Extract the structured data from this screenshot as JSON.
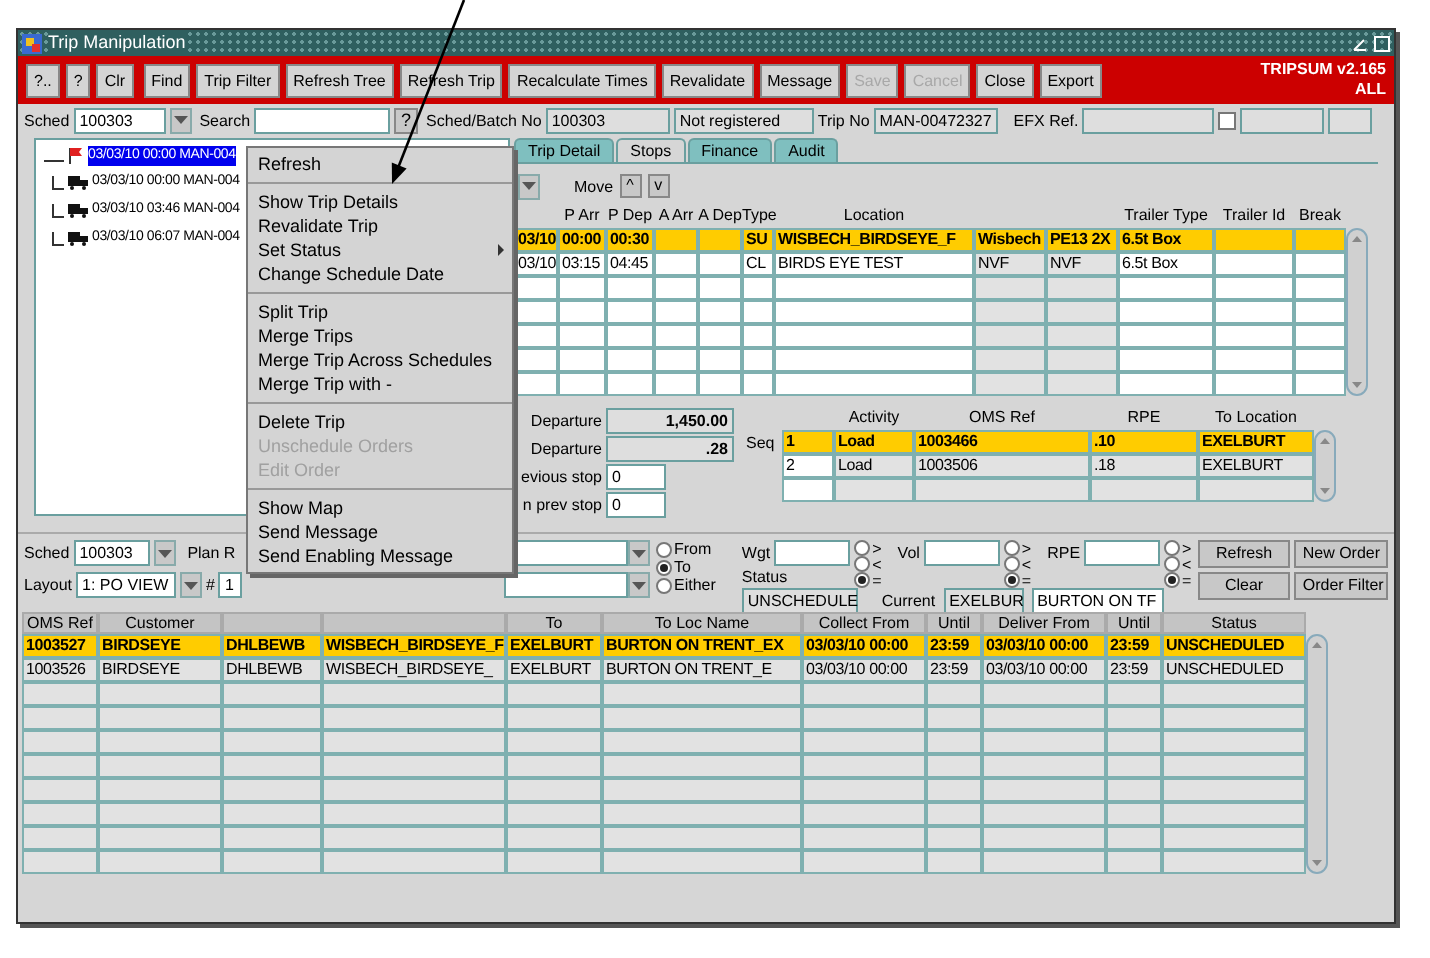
{
  "window": {
    "title": "Trip Manipulation"
  },
  "toolbar": {
    "buttons": [
      {
        "label": "?..",
        "disabled": false
      },
      {
        "label": "?",
        "disabled": false
      },
      {
        "label": "Clr",
        "disabled": false
      },
      {
        "label": "Find",
        "disabled": false
      },
      {
        "label": "Trip Filter",
        "disabled": false
      },
      {
        "label": "Refresh Tree",
        "disabled": false
      },
      {
        "label": "Refresh Trip",
        "disabled": false
      },
      {
        "label": "Recalculate Times",
        "disabled": false
      },
      {
        "label": "Revalidate",
        "disabled": false
      },
      {
        "label": "Message",
        "disabled": false
      },
      {
        "label": "Save",
        "disabled": true
      },
      {
        "label": "Cancel",
        "disabled": true
      },
      {
        "label": "Close",
        "disabled": false
      },
      {
        "label": "Export",
        "disabled": false
      }
    ],
    "app_version": "TRIPSUM v2.165",
    "scope": "ALL"
  },
  "header": {
    "sched_label": "Sched",
    "sched": "100303",
    "search_label": "Search",
    "search_button": "?",
    "batch_label": "Sched/Batch No",
    "batch": "100303",
    "registration": "Not registered",
    "trip_no_label": "Trip No",
    "trip_no": "MAN-00472327",
    "efx_label": "EFX Ref.",
    "efx_checked": false
  },
  "tree": {
    "items": [
      {
        "label": "03/03/10 00:00 MAN-004",
        "selected": true,
        "children": [
          {
            "label": "03/03/10 00:00 MAN-004",
            "selected": false
          },
          {
            "label": "03/03/10 03:46 MAN-004",
            "selected": false
          },
          {
            "label": "03/03/10 06:07 MAN-004",
            "selected": false
          }
        ]
      }
    ]
  },
  "tabs": [
    {
      "label": "Trip Detail",
      "selected": false
    },
    {
      "label": "Stops",
      "selected": true
    },
    {
      "label": "Finance",
      "selected": false
    },
    {
      "label": "Audit",
      "selected": false
    }
  ],
  "stops": {
    "move_label": "Move",
    "move_up": "^",
    "move_down": "v",
    "columns": [
      null,
      "P Arr",
      "P Dep",
      "A Arr",
      "A Dep",
      "Type",
      "Location",
      null,
      null,
      "Trailer Type",
      "Trailer Id",
      "Break"
    ],
    "rows": [
      {
        "selected": true,
        "cells": [
          "03/10",
          "00:00",
          "00:30",
          null,
          null,
          "SU",
          "WISBECH_BIRDSEYE_F",
          "Wisbech",
          "PE13 2X",
          "6.5t Box",
          null,
          null
        ]
      },
      {
        "selected": false,
        "cells": [
          "03/10",
          "03:15",
          "04:45",
          null,
          null,
          "CL",
          "BIRDS EYE TEST",
          "NVF",
          "NVF",
          "6.5t Box",
          null,
          null
        ]
      }
    ]
  },
  "stop_summary": [
    {
      "kind": "total",
      "label": "Departure",
      "value": "1,450.00"
    },
    {
      "kind": "total",
      "label": "Departure",
      "value": ".28"
    },
    {
      "kind": "input",
      "label": "evious stop",
      "value": "0"
    },
    {
      "kind": "input",
      "label": "n prev stop",
      "value": "0"
    }
  ],
  "activities": {
    "seq_label": "Seq",
    "columns": [
      null,
      "Activity",
      "OMS Ref",
      "RPE",
      "To Location"
    ],
    "rows": [
      {
        "selected": true,
        "cells": [
          "1",
          "Load",
          "1003466",
          ".10",
          "EXELBURT"
        ]
      },
      {
        "selected": false,
        "cells": [
          "2",
          "Load",
          "1003506",
          ".18",
          "EXELBURT"
        ]
      }
    ]
  },
  "filters": {
    "sched_label": "Sched",
    "sched": "100303",
    "plan_label": "Plan R",
    "layout_label": "Layout",
    "layout": "1: PO VIEW",
    "hash_label": "#",
    "hash_value": "1",
    "direction": [
      {
        "label": "From",
        "selected": false
      },
      {
        "label": "To",
        "selected": true
      },
      {
        "label": "Either",
        "selected": false
      }
    ],
    "measures": [
      {
        "label": "Wgt",
        "compare": [
          {
            "label": ">",
            "selected": false
          },
          {
            "label": "<",
            "selected": false
          },
          {
            "label": "=",
            "selected": true
          }
        ]
      },
      {
        "label": "Vol",
        "compare": [
          {
            "label": ">",
            "selected": false
          },
          {
            "label": "<",
            "selected": false
          },
          {
            "label": "=",
            "selected": true
          }
        ]
      },
      {
        "label": "RPE",
        "compare": [
          {
            "label": ">",
            "selected": false
          },
          {
            "label": "<",
            "selected": false
          },
          {
            "label": "=",
            "selected": true
          }
        ]
      }
    ],
    "status_label": "Status",
    "status": "UNSCHEDULE",
    "current_label": "Current",
    "current_code": "EXELBUR",
    "current_name": "BURTON ON TF",
    "buttons": [
      "Refresh",
      "New Order",
      "Clear",
      "Order Filter"
    ]
  },
  "orders": {
    "columns": [
      "OMS Ref",
      "Customer",
      null,
      null,
      "To",
      "To Loc Name",
      "Collect From",
      "Until",
      "Deliver From",
      "Until",
      "Status"
    ],
    "rows": [
      {
        "selected": true,
        "cells": [
          "1003527",
          "BIRDSEYE",
          "DHLBEWB",
          "WISBECH_BIRDSEYE_F",
          "EXELBURT",
          "BURTON ON TRENT_EX",
          "03/03/10 00:00",
          "23:59",
          "03/03/10 00:00",
          "23:59",
          "UNSCHEDULED"
        ]
      },
      {
        "selected": false,
        "cells": [
          "1003526",
          "BIRDSEYE",
          "DHLBEWB",
          "WISBECH_BIRDSEYE_",
          "EXELBURT",
          "BURTON ON TRENT_E",
          "03/03/10 00:00",
          "23:59",
          "03/03/10 00:00",
          "23:59",
          "UNSCHEDULED"
        ]
      }
    ]
  },
  "context_menu": {
    "items": [
      {
        "kind": "item",
        "label": "Refresh",
        "disabled": false,
        "submenu": false
      },
      {
        "kind": "separator"
      },
      {
        "kind": "item",
        "label": "Show Trip Details",
        "disabled": false,
        "submenu": false
      },
      {
        "kind": "item",
        "label": "Revalidate Trip",
        "disabled": false,
        "submenu": false
      },
      {
        "kind": "item",
        "label": "Set Status",
        "disabled": false,
        "submenu": true
      },
      {
        "kind": "item",
        "label": "Change Schedule Date",
        "disabled": false,
        "submenu": false
      },
      {
        "kind": "separator"
      },
      {
        "kind": "item",
        "label": "Split Trip",
        "disabled": false,
        "submenu": false
      },
      {
        "kind": "item",
        "label": "Merge Trips",
        "disabled": false,
        "submenu": false
      },
      {
        "kind": "item",
        "label": "Merge Trip Across Schedules",
        "disabled": false,
        "submenu": false
      },
      {
        "kind": "item",
        "label": "Merge Trip with -",
        "disabled": false,
        "submenu": false
      },
      {
        "kind": "separator"
      },
      {
        "kind": "item",
        "label": "Delete Trip",
        "disabled": false,
        "submenu": false
      },
      {
        "kind": "item",
        "label": "Unschedule Orders",
        "disabled": true,
        "submenu": false
      },
      {
        "kind": "item",
        "label": "Edit Order",
        "disabled": true,
        "submenu": false
      },
      {
        "kind": "separator"
      },
      {
        "kind": "item",
        "label": "Show Map",
        "disabled": false,
        "submenu": false
      },
      {
        "kind": "item",
        "label": "Send Message",
        "disabled": false,
        "submenu": false
      },
      {
        "kind": "item",
        "label": "Send Enabling Message",
        "disabled": false,
        "submenu": false
      }
    ]
  }
}
